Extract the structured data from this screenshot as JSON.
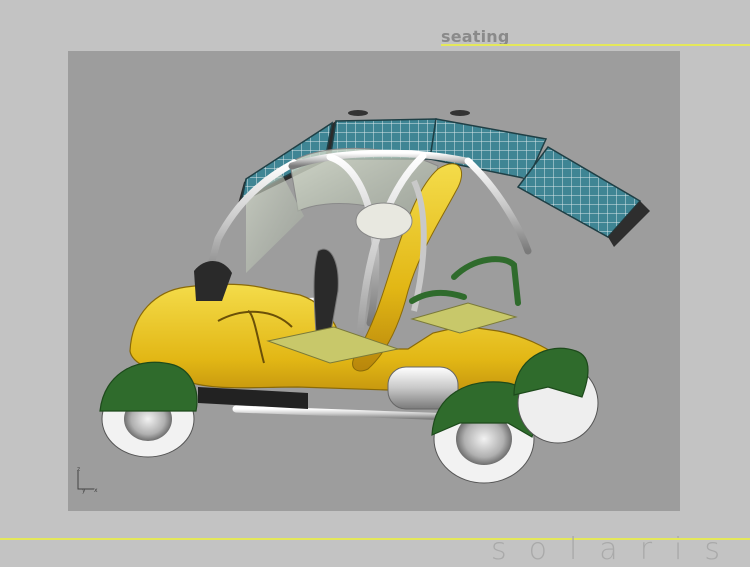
{
  "header": {
    "title": "seating"
  },
  "viewport": {
    "render": "3d-solar-car-model",
    "axis_labels": {
      "z": "z",
      "y": "y",
      "x": "x"
    }
  },
  "footer": {
    "brand": "solaris"
  },
  "colors": {
    "background": "#c3c3c3",
    "viewport": "#9d9d9d",
    "accent_line": "#e4e85a",
    "body_yellow": "#e8c21a",
    "fender_green": "#2f6b2c",
    "solar_panel": "#3b7a86"
  }
}
